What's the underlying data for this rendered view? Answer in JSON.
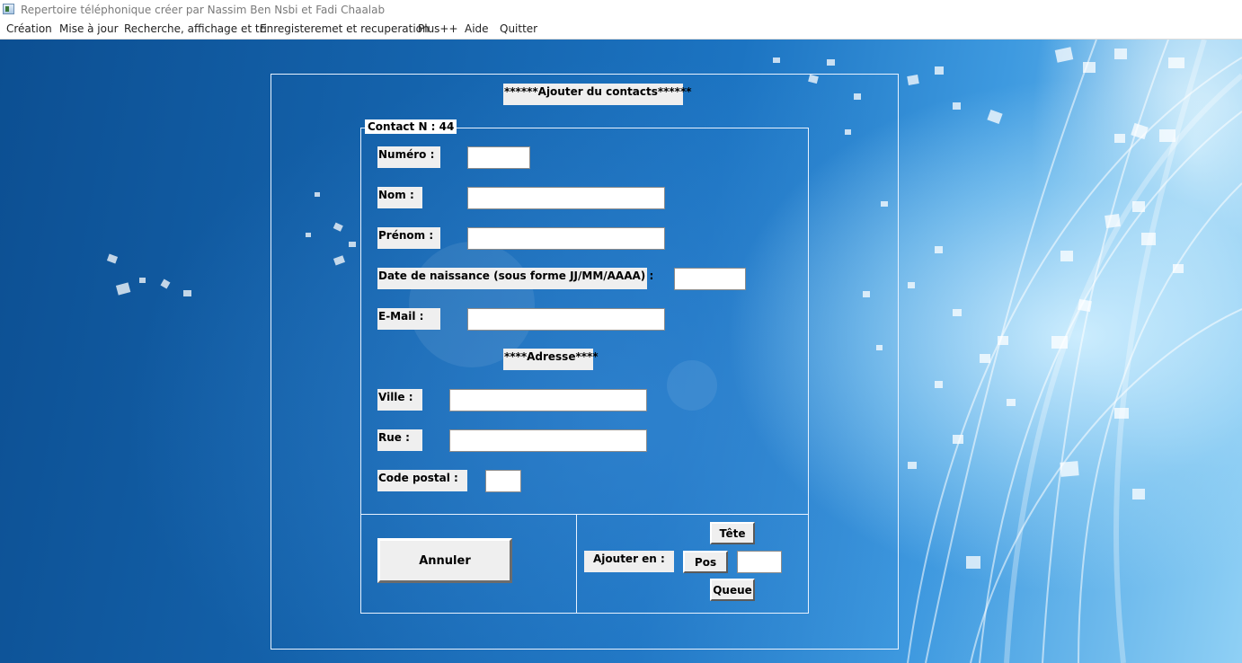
{
  "window": {
    "title": "Repertoire téléphonique créer par Nassim Ben Nsbi et Fadi Chaalab"
  },
  "menu": {
    "creation": "Création",
    "mise_a_jour": "Mise à jour",
    "recherche": "Recherche, affichage et tri",
    "enregistrement": "Enregisteremet et recuperation",
    "plus": "Plus++",
    "aide": "Aide",
    "quitter": "Quitter"
  },
  "form": {
    "heading": "******Ajouter du contacts******",
    "group_title": "Contact N : 44",
    "numero_label": "Numéro :",
    "numero_value": "",
    "nom_label": "Nom :",
    "nom_value": "",
    "prenom_label": "Prénom :",
    "prenom_value": "",
    "date_label": "Date de naissance (sous forme JJ/MM/AAAA) :",
    "date_value": "",
    "email_label": "E-Mail :",
    "email_value": "",
    "adresse_heading": "****Adresse****",
    "ville_label": "Ville :",
    "ville_value": "",
    "rue_label": "Rue :",
    "rue_value": "",
    "code_postal_label": "Code postal :",
    "code_postal_value": ""
  },
  "actions": {
    "annuler": "Annuler",
    "ajouter_en_label": "Ajouter en :",
    "tete": "Tête",
    "pos": "Pos",
    "pos_value": "",
    "queue": "Queue"
  },
  "colors": {
    "background_dark": "#0c4f92",
    "background_light": "#8fd0f5",
    "label_bg": "#efefef",
    "frame_line": "#e8f2ff"
  }
}
